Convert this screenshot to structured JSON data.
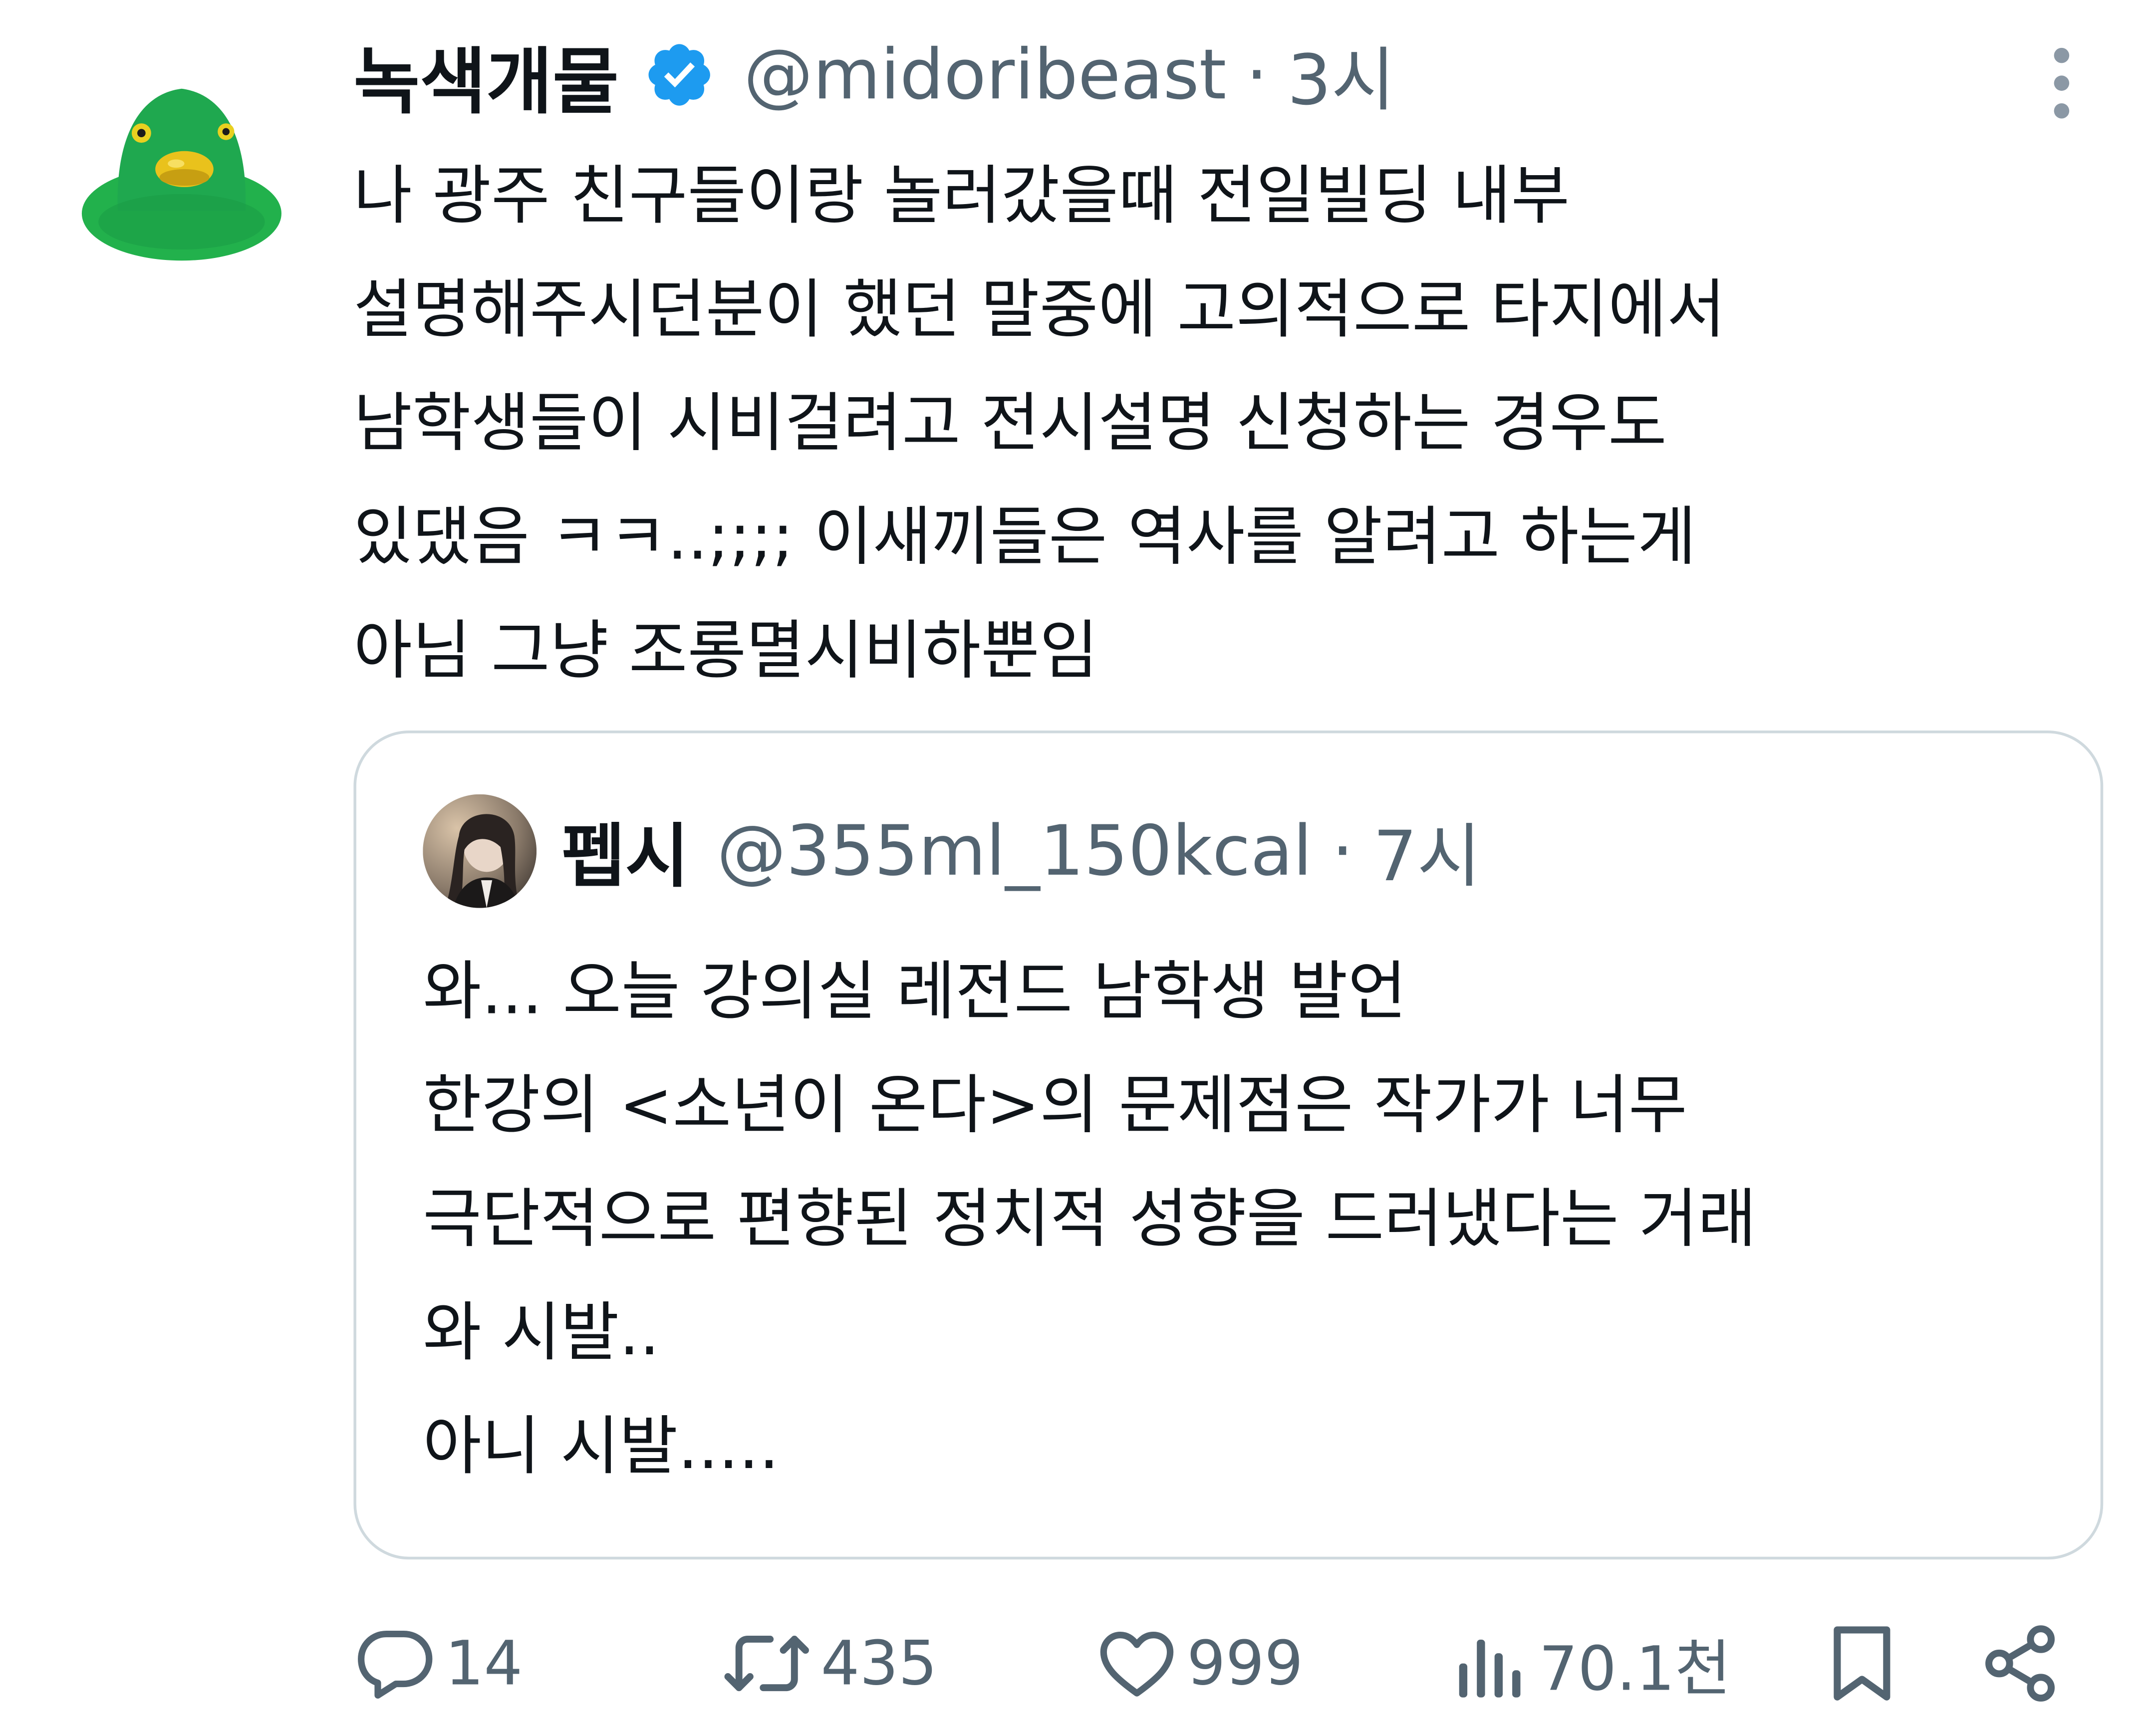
{
  "tweet": {
    "author": {
      "display_name": "녹색개물",
      "handle": "@midoribeast",
      "verified": true,
      "avatar_icon": "green-duck-avatar"
    },
    "separator": "·",
    "time": "3시",
    "text": "나 광주 친구들이랑 놀러갔을때 전일빌딩 내부\n설명해주시던분이 했던 말중에 고의적으로 타지에서\n남학생들이 시비걸려고 전시설명 신청하는 경우도\n있댔음 ㅋㅋ..;;;; 이새끼들은 역사를 알려고 하는게\n아님 그냥 조롱멸시비하뿐임"
  },
  "quoted_tweet": {
    "author": {
      "display_name": "펩시",
      "handle": "@355ml_150kcal",
      "avatar_icon": "profile-photo-avatar"
    },
    "separator": "·",
    "time": "7시",
    "text": "와... 오늘 강의실 레전드 남학생 발언\n한강의 <소년이 온다>의 문제점은 작가가 너무\n극단적으로 편향된 정치적 성향을 드러냈다는 거래\n와 시발..\n아니 시발....."
  },
  "actions": {
    "reply_count": "14",
    "retweet_count": "435",
    "like_count": "999",
    "view_count": "70.1천"
  },
  "colors": {
    "text": "#0f1419",
    "secondary": "#536471",
    "border": "#cfd9de",
    "verified": "#1d9bf0",
    "avatar_green": "#1fa84f",
    "beak_yellow": "#e9c21c"
  }
}
